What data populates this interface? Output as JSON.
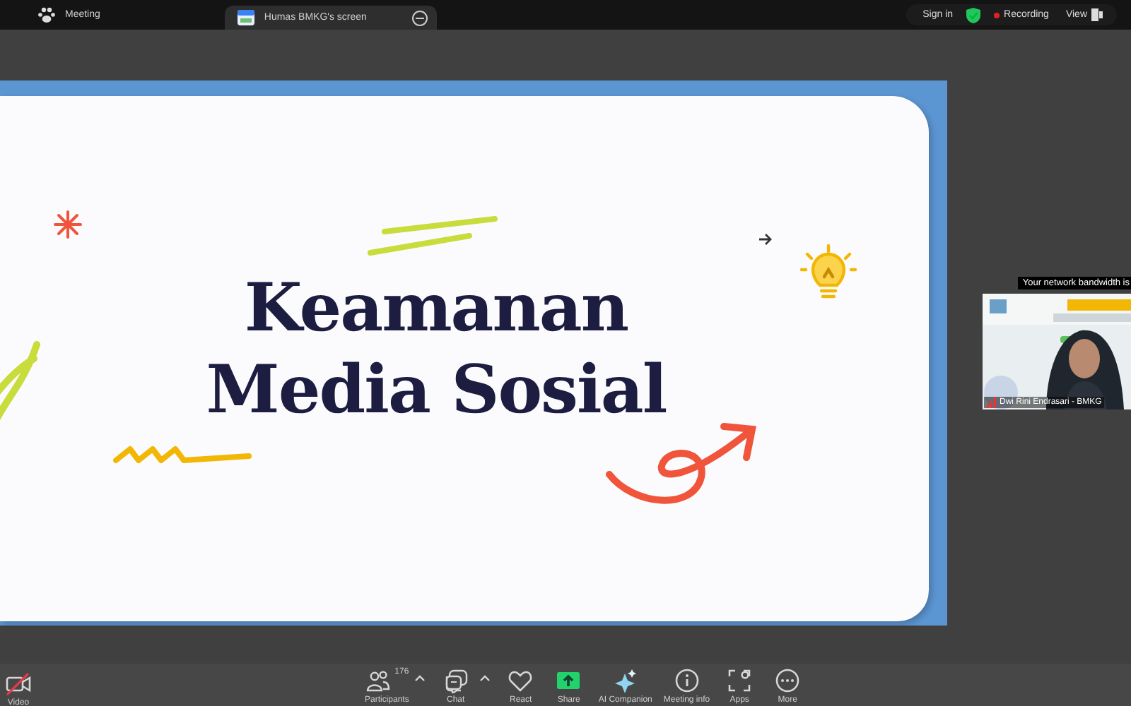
{
  "top_bar": {
    "tabs": [
      {
        "label": "Meeting",
        "kind": "meeting",
        "selected": false
      },
      {
        "label": "Humas BMKG's screen",
        "kind": "screen",
        "selected": true
      }
    ],
    "sign_in": "Sign in",
    "recording": {
      "label": "Recording",
      "on": true
    },
    "view": "View"
  },
  "slide": {
    "title_lines": [
      "Keamanan",
      "Media Sosial"
    ]
  },
  "video_tile": {
    "notice": "Your network bandwidth is",
    "name": "Dwi Rini Endrasari - BMKG",
    "kind": "picture"
  },
  "toolbar": {
    "items": [
      {
        "label": "Video",
        "kind": "video-off",
        "has_menu": false
      },
      {
        "label": "Participants",
        "kind": "participants",
        "count": "176",
        "has_menu": true
      },
      {
        "label": "Chat",
        "kind": "chat",
        "has_menu": true
      },
      {
        "label": "React",
        "kind": "react",
        "has_menu": false
      },
      {
        "label": "Share",
        "kind": "share",
        "has_menu": false
      },
      {
        "label": "AI Companion",
        "kind": "ai",
        "has_menu": false
      },
      {
        "label": "Meeting info",
        "kind": "info",
        "has_menu": false
      },
      {
        "label": "Apps",
        "kind": "apps",
        "has_menu": false
      },
      {
        "label": "More",
        "kind": "more",
        "has_menu": false
      }
    ]
  }
}
